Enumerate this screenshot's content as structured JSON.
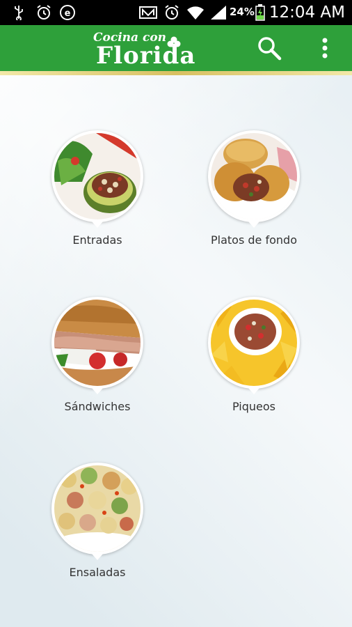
{
  "status_bar": {
    "battery_percent": "24%",
    "time": "12:04 AM"
  },
  "app_bar": {
    "logo_top": "Cocina con",
    "logo_main": "Florida"
  },
  "categories": [
    {
      "label": "Entradas"
    },
    {
      "label": "Platos de fondo"
    },
    {
      "label": "Sándwiches"
    },
    {
      "label": "Piqueos"
    },
    {
      "label": "Ensaladas"
    }
  ]
}
